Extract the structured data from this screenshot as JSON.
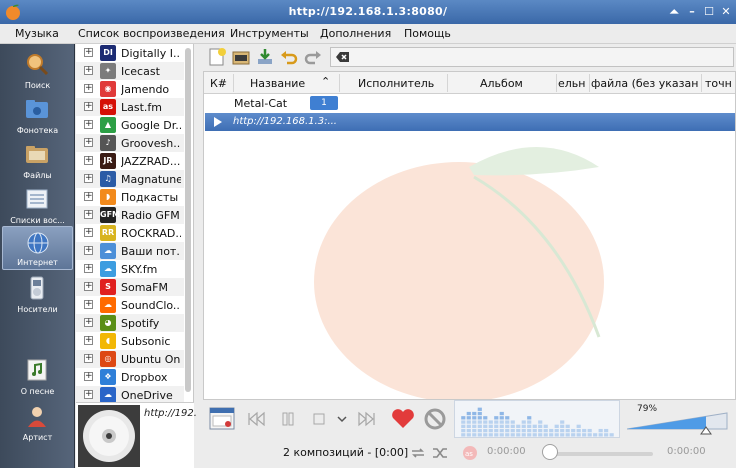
{
  "window": {
    "title": "http://192.168.1.3:8080/"
  },
  "menu": [
    "Музыка",
    "Список воспроизведения",
    "Инструменты",
    "Дополнения",
    "Помощь"
  ],
  "nav": [
    {
      "label": "Поиск",
      "icon": "search-icon"
    },
    {
      "label": "Фонотека",
      "icon": "library-folder-icon"
    },
    {
      "label": "Файлы",
      "icon": "files-folder-icon"
    },
    {
      "label": "Списки вос...",
      "icon": "playlists-icon"
    },
    {
      "label": "Интернет",
      "icon": "globe-icon",
      "active": true
    },
    {
      "label": "Носители",
      "icon": "device-icon"
    },
    {
      "label": "О песне",
      "icon": "song-info-icon"
    },
    {
      "label": "Артист",
      "icon": "artist-icon"
    }
  ],
  "services": [
    {
      "label": "Digitally I...",
      "icon": "digitally-imported-icon",
      "glyph": "DI",
      "color": "#1c2b73"
    },
    {
      "label": "Icecast",
      "icon": "icecast-icon",
      "glyph": "✦",
      "color": "#7b7b7b"
    },
    {
      "label": "Jamendo",
      "icon": "jamendo-icon",
      "glyph": "◉",
      "color": "#e03a3a"
    },
    {
      "label": "Last.fm",
      "icon": "lastfm-icon",
      "glyph": "as",
      "color": "#d51007"
    },
    {
      "label": "Google Dr...",
      "icon": "google-drive-icon",
      "glyph": "▲",
      "color": "#2c9f45"
    },
    {
      "label": "Groovesh...",
      "icon": "grooveshark-icon",
      "glyph": "♪",
      "color": "#555555"
    },
    {
      "label": "JAZZRAD...",
      "icon": "jazzradio-icon",
      "glyph": "JR",
      "color": "#3a1b14"
    },
    {
      "label": "Magnatune",
      "icon": "magnatune-icon",
      "glyph": "♫",
      "color": "#2b5ba6"
    },
    {
      "label": "Подкасты",
      "icon": "podcasts-icon",
      "glyph": "◗",
      "color": "#f28a1c"
    },
    {
      "label": "Radio GFM",
      "icon": "radio-gfm-icon",
      "glyph": "GFM",
      "color": "#222222"
    },
    {
      "label": "ROCKRAD...",
      "icon": "rockradio-icon",
      "glyph": "RR",
      "color": "#d8b41f"
    },
    {
      "label": "Ваши пот...",
      "icon": "your-streams-icon",
      "glyph": "☁",
      "color": "#4c8fd8"
    },
    {
      "label": "SKY.fm",
      "icon": "skyfm-icon",
      "glyph": "☁",
      "color": "#3d9de0"
    },
    {
      "label": "SomaFM",
      "icon": "somafm-icon",
      "glyph": "S",
      "color": "#e0201f"
    },
    {
      "label": "SoundClo...",
      "icon": "soundcloud-icon",
      "glyph": "☁",
      "color": "#ff6a00"
    },
    {
      "label": "Spotify",
      "icon": "spotify-icon",
      "glyph": "◕",
      "color": "#5a8f16"
    },
    {
      "label": "Subsonic",
      "icon": "subsonic-icon",
      "glyph": "◖",
      "color": "#f2b705"
    },
    {
      "label": "Ubuntu One",
      "icon": "ubuntu-one-icon",
      "glyph": "◎",
      "color": "#dd4814"
    },
    {
      "label": "Dropbox",
      "icon": "dropbox-icon",
      "glyph": "❖",
      "color": "#2f7fd8"
    },
    {
      "label": "OneDrive",
      "icon": "onedrive-icon",
      "glyph": "☁",
      "color": "#2a65c8"
    }
  ],
  "now_playing": {
    "text": "http://192."
  },
  "toolbar_icons": [
    "new-playlist-icon",
    "open-playlist-icon",
    "save-playlist-icon",
    "undo-icon",
    "redo-icon"
  ],
  "columns": [
    "К#",
    "Название",
    "Исполнитель",
    "Альбом",
    "ельн",
    "файла (без указания",
    "точн"
  ],
  "group": {
    "label": "Metal-Cat",
    "count": "1"
  },
  "track": {
    "title": "http://192.168.1.3:..."
  },
  "volume": {
    "label": "79%",
    "level": 0.79
  },
  "status": {
    "text": "2 композиций - [0:00]",
    "time_elapsed": "0:00:00",
    "time_total": "0:00:00",
    "seek_level": 0
  },
  "colors": {
    "accent": "#3f7fd2",
    "titlebar": "#4a78b8",
    "nav_bg": "#4a5668",
    "love": "#e23b3b"
  }
}
